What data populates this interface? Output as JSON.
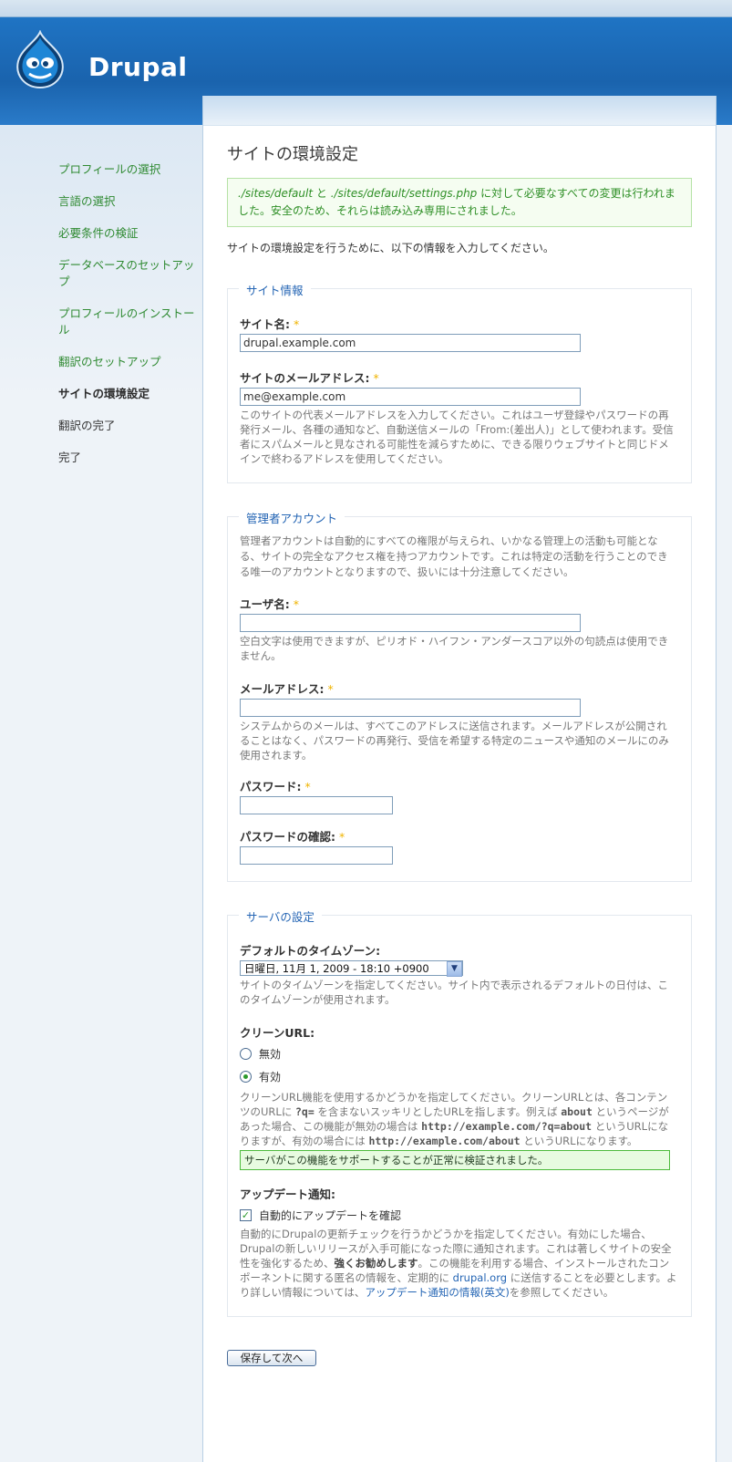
{
  "header": {
    "site_name": "Drupal",
    "logo_icon": "drupal-drop-icon"
  },
  "sidebar": {
    "items": [
      {
        "label": "プロフィールの選択",
        "state": "done"
      },
      {
        "label": "言語の選択",
        "state": "done"
      },
      {
        "label": "必要条件の検証",
        "state": "done"
      },
      {
        "label": "データベースのセットアップ",
        "state": "done"
      },
      {
        "label": "プロフィールのインストール",
        "state": "done"
      },
      {
        "label": "翻訳のセットアップ",
        "state": "done"
      },
      {
        "label": "サイトの環境設定",
        "state": "active"
      },
      {
        "label": "翻訳の完了",
        "state": "pending"
      },
      {
        "label": "完了",
        "state": "pending"
      }
    ]
  },
  "page": {
    "title": "サイトの環境設定",
    "message": {
      "path1": "./sites/default",
      "and": " と ",
      "path2": "./sites/default/settings.php",
      "text": " に対して必要なすべての変更は行われました。安全のため、それらは読み込み専用にされました。"
    },
    "intro": "サイトの環境設定を行うために、以下の情報を入力してください。"
  },
  "site_info": {
    "legend": "サイト情報",
    "site_name_label": "サイト名:",
    "site_name_value": "drupal.example.com",
    "site_mail_label": "サイトのメールアドレス:",
    "site_mail_value": "me@example.com",
    "site_mail_desc": "このサイトの代表メールアドレスを入力してください。これはユーザ登録やパスワードの再発行メール、各種の通知など、自動送信メールの「From:(差出人)」として使われます。受信者にスパムメールと見なされる可能性を減らすために、できる限りウェブサイトと同じドメインで終わるアドレスを使用してください。"
  },
  "admin": {
    "legend": "管理者アカウント",
    "desc": "管理者アカウントは自動的にすべての権限が与えられ、いかなる管理上の活動も可能となる、サイトの完全なアクセス権を持つアカウントです。これは特定の活動を行うことのできる唯一のアカウントとなりますので、扱いには十分注意してください。",
    "username_label": "ユーザ名:",
    "username_value": "",
    "username_desc": "空白文字は使用できますが、ピリオド・ハイフン・アンダースコア以外の句読点は使用できません。",
    "mail_label": "メールアドレス:",
    "mail_value": "",
    "mail_desc": "システムからのメールは、すべてこのアドレスに送信されます。メールアドレスが公開されることはなく、パスワードの再発行、受信を希望する特定のニュースや通知のメールにのみ使用されます。",
    "pass_label": "パスワード:",
    "pass_confirm_label": "パスワードの確認:",
    "required_mark": "*"
  },
  "server": {
    "legend": "サーバの設定",
    "tz_label": "デフォルトのタイムゾーン:",
    "tz_value": "日曜日, 11月 1, 2009 - 18:10 +0900",
    "tz_desc": "サイトのタイムゾーンを指定してください。サイト内で表示されるデフォルトの日付は、このタイムゾーンが使用されます。",
    "clean_label": "クリーンURL:",
    "clean_off": "無効",
    "clean_on": "有効",
    "clean_selected": "有効",
    "clean_desc_1": "クリーンURL機能を使用するかどうかを指定してください。クリーンURLとは、各コンテンツのURLに ",
    "clean_desc_q": "?q=",
    "clean_desc_2": " を含まないスッキリとしたURLを指します。例えば ",
    "clean_desc_about": "about",
    "clean_desc_3": " というページがあった場合、この機能が無効の場合は ",
    "clean_desc_url1": "http://example.com/?q=about",
    "clean_desc_4": " というURLになりますが、有効の場合には ",
    "clean_desc_url2": "http://example.com/about",
    "clean_desc_5": " というURLになります。",
    "clean_ok": "サーバがこの機能をサポートすることが正常に検証されました。",
    "update_label": "アップデート通知:",
    "update_check": "自動的にアップデートを確認",
    "update_checked": true,
    "update_desc_1": "自動的にDrupalの更新チェックを行うかどうかを指定してください。有効にした場合、Drupalの新しいリリースが入手可能になった際に通知されます。これは著しくサイトの安全性を強化するため、",
    "update_desc_strong": "強くお勧めします",
    "update_desc_2": "。この機能を利用する場合、インストールされたコンポーネントに関する匿名の情報を、定期的に ",
    "update_desc_link1": "drupal.org",
    "update_desc_3": " に送信することを必要とします。より詳しい情報については、",
    "update_desc_link2": "アップデート通知の情報(英文)",
    "update_desc_4": "を参照してください。"
  },
  "submit_label": "保存して次へ",
  "colors": {
    "header_blue": "#1a63ad",
    "nav_green": "#2f8a32",
    "legend_blue": "#2465b4",
    "required": "#f0b400"
  }
}
